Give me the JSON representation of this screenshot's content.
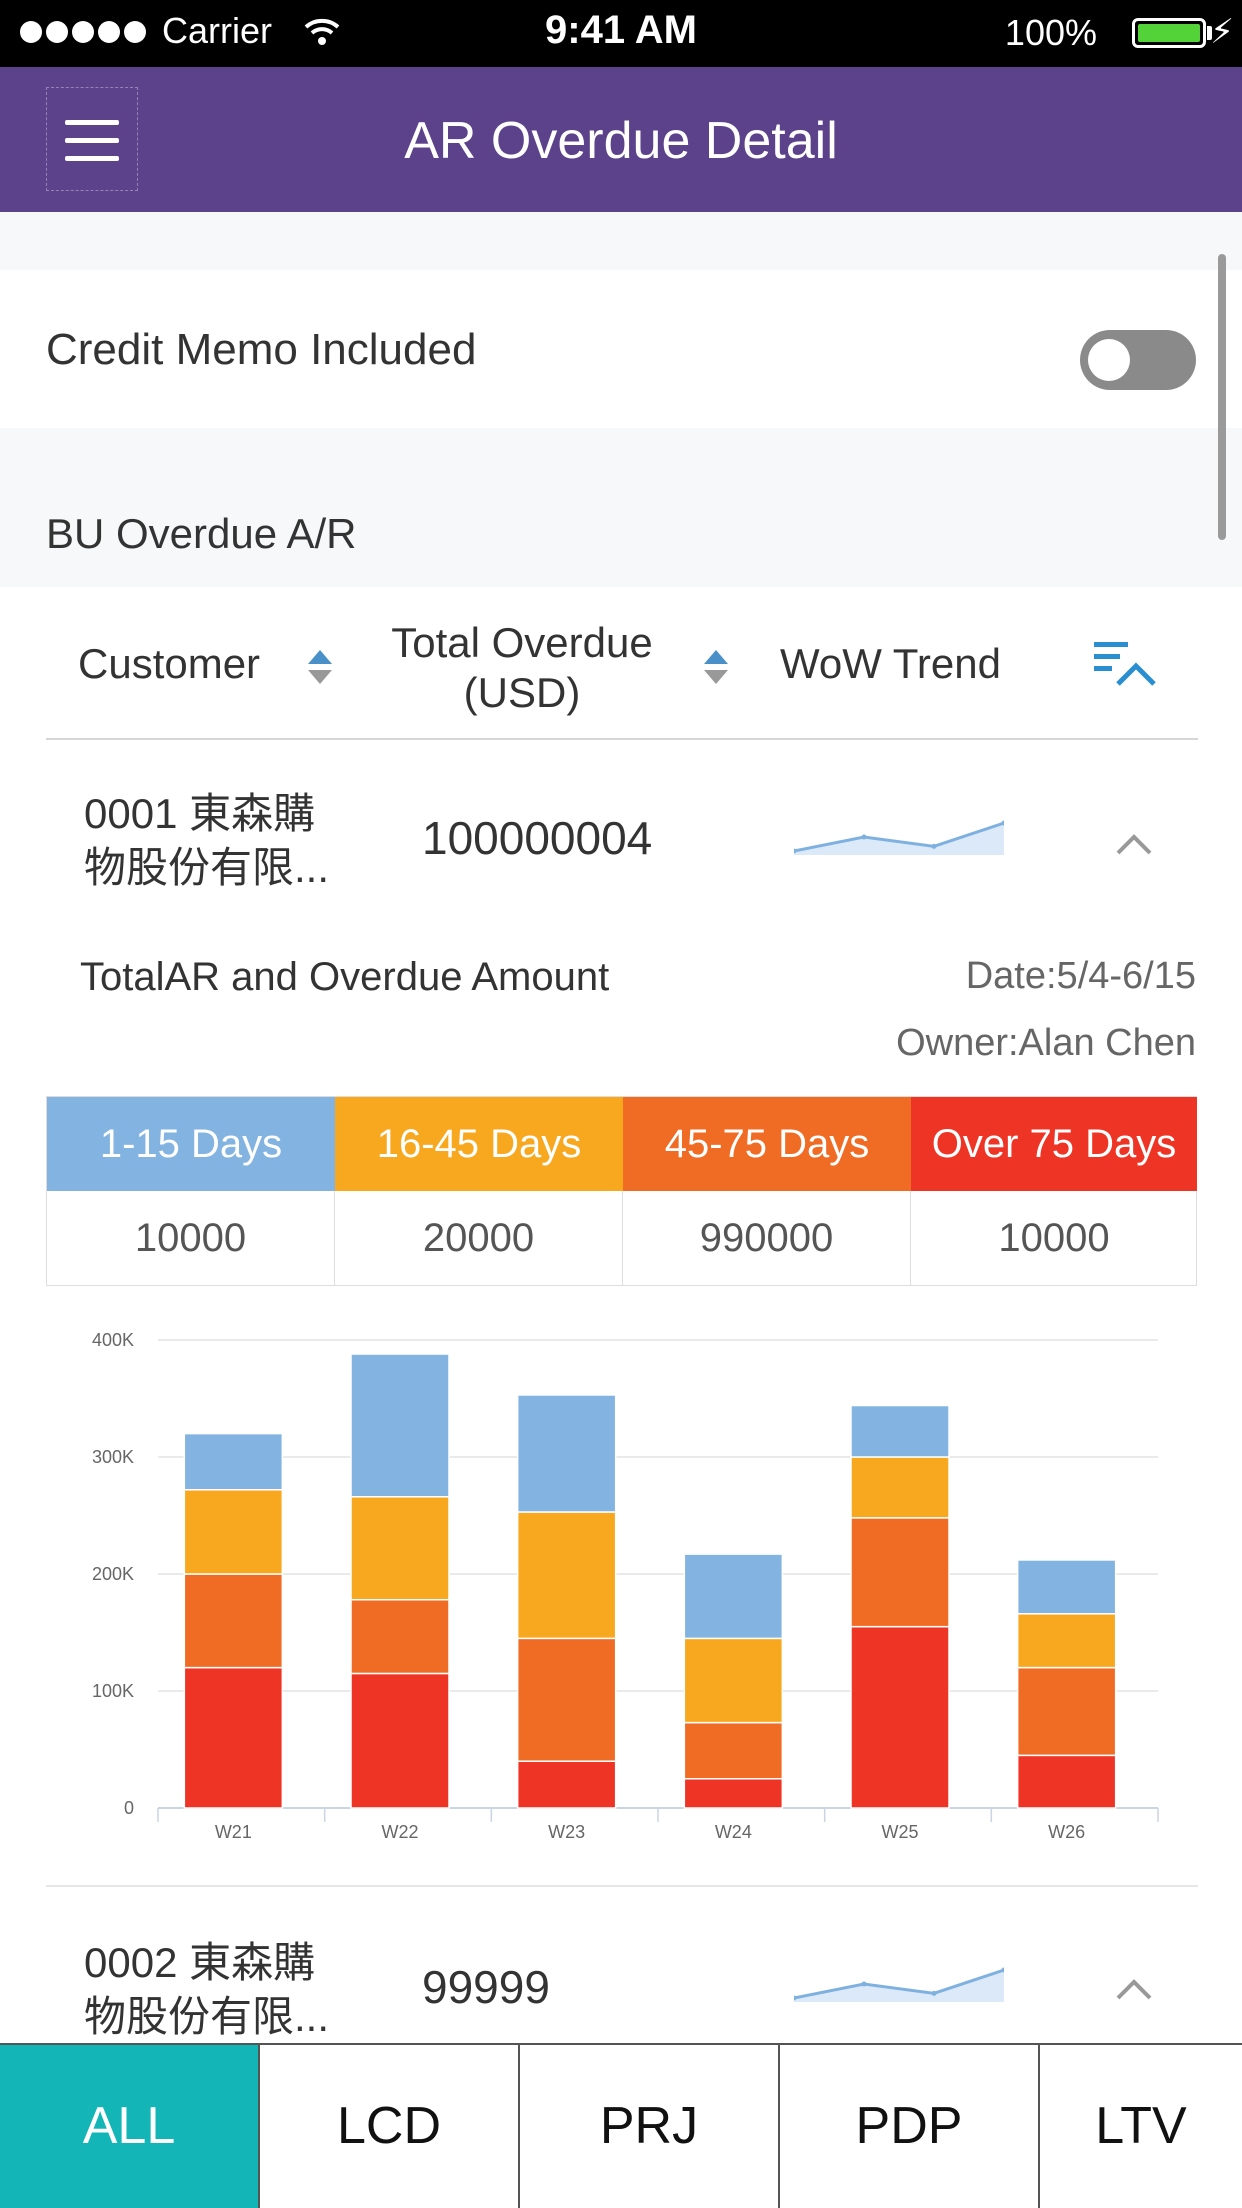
{
  "status_bar": {
    "carrier": "Carrier",
    "time": "9:41 AM",
    "battery": "100%"
  },
  "nav": {
    "title": "AR Overdue Detail",
    "menu_icon": "hamburger-icon"
  },
  "settings": {
    "credit_memo_label": "Credit Memo Included",
    "credit_memo_enabled": false
  },
  "section": {
    "title": "BU Overdue A/R"
  },
  "table_header": {
    "customer": "Customer",
    "total_overdue_line1": "Total Overdue",
    "total_overdue_line2": "(USD)",
    "wow_trend": "WoW Trend"
  },
  "rows": [
    {
      "customer_line1": "0001 東森購",
      "customer_line2": "物股份有限...",
      "amount": "100000004",
      "trend": [
        2,
        5,
        3,
        8
      ]
    },
    {
      "customer_line1": "0002 東森購",
      "customer_line2": "物股份有限...",
      "amount": "99999",
      "trend": [
        2,
        5,
        3,
        8
      ]
    }
  ],
  "detail": {
    "title": "TotalAR and Overdue Amount",
    "date": "Date:5/4-6/15",
    "owner": "Owner:Alan Chen",
    "aging": [
      {
        "label": "1-15 Days",
        "value": "10000",
        "color": "#82b3e1"
      },
      {
        "label": "16-45 Days",
        "value": "20000",
        "color": "#f8a81f"
      },
      {
        "label": "45-75 Days",
        "value": "990000",
        "color": "#f06b23"
      },
      {
        "label": "Over 75 Days",
        "value": "10000",
        "color": "#ee3424"
      }
    ]
  },
  "chart_data": {
    "type": "bar",
    "stacked": true,
    "categories": [
      "W21",
      "W22",
      "W23",
      "W24",
      "W25",
      "W26"
    ],
    "ylim": [
      0,
      400000
    ],
    "yticks": [
      "0",
      "100K",
      "200K",
      "300K",
      "400K"
    ],
    "series": [
      {
        "name": "Over 75 Days",
        "color": "#ee3424",
        "values": [
          120000,
          115000,
          40000,
          25000,
          155000,
          45000
        ]
      },
      {
        "name": "45-75 Days",
        "color": "#f06b23",
        "values": [
          80000,
          63000,
          105000,
          48000,
          93000,
          75000
        ]
      },
      {
        "name": "16-45 Days",
        "color": "#f8a81f",
        "values": [
          72000,
          88000,
          108000,
          72000,
          52000,
          46000
        ]
      },
      {
        "name": "1-15 Days",
        "color": "#82b3e1",
        "values": [
          48000,
          122000,
          100000,
          72000,
          44000,
          46000
        ]
      }
    ],
    "grid": true
  },
  "tabs": [
    {
      "label": "ALL",
      "active": true
    },
    {
      "label": "LCD",
      "active": false
    },
    {
      "label": "PRJ",
      "active": false
    },
    {
      "label": "PDP",
      "active": false
    },
    {
      "label": "LTV",
      "active": false
    }
  ]
}
